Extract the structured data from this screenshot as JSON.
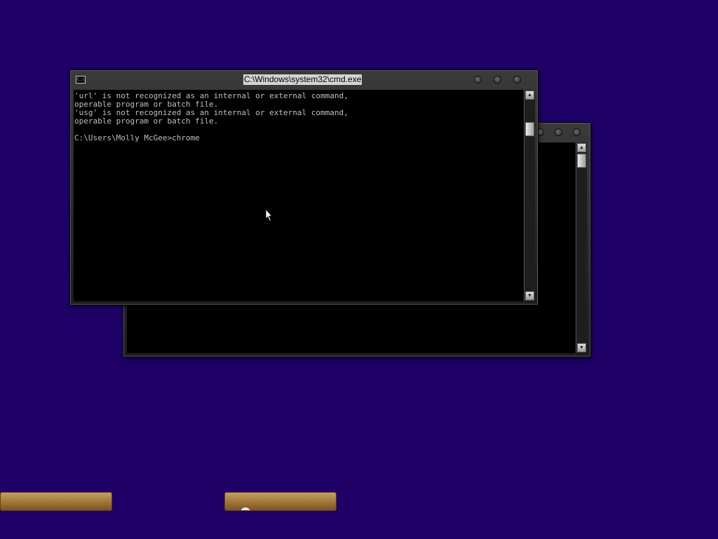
{
  "window_front": {
    "title": "C:\\Windows\\system32\\cmd.exe",
    "console_lines": [
      "'url' is not recognized as an internal or external command,",
      "operable program or batch file.",
      "'usg' is not recognized as an internal or external command,",
      "operable program or batch file.",
      "",
      "C:\\Users\\Molly McGee>chrome"
    ]
  },
  "window_back": {
    "title": ""
  },
  "taskbar": {
    "buttons": [
      {
        "label": ""
      },
      {
        "label": ""
      }
    ]
  },
  "colors": {
    "desktop": "#1e0066",
    "console_bg": "#000000",
    "console_text": "#c0c0c0",
    "taskbar_button": "#9b7134"
  },
  "icons": {
    "system_menu": "cmd-icon",
    "minimize": "circle-button",
    "maximize": "circle-button",
    "close": "circle-button",
    "cursor": "mouse-pointer-icon"
  }
}
